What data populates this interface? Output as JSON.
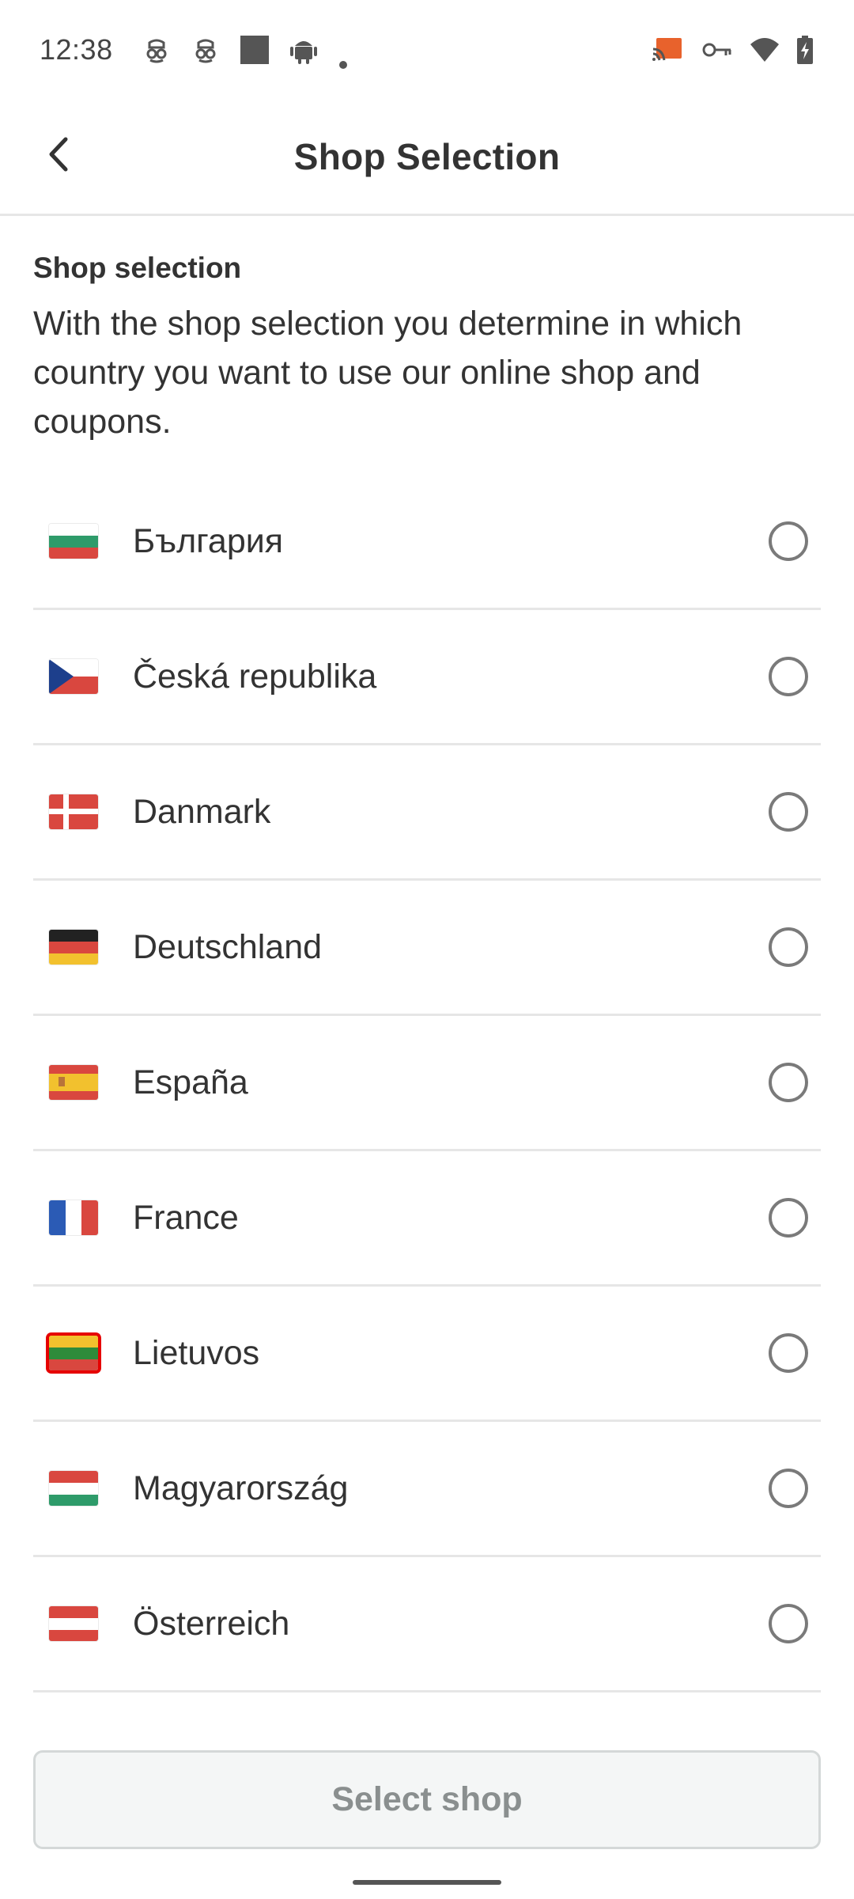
{
  "status_bar": {
    "time": "12:38",
    "left_icons": [
      "incognito-icon",
      "incognito-icon",
      "square-icon",
      "android-icon",
      "dot-icon"
    ],
    "right_icons": [
      "cast-icon",
      "vpn-key-icon",
      "wifi-icon",
      "battery-charging-icon"
    ]
  },
  "app_bar": {
    "title": "Shop Selection",
    "back_icon": "chevron-left-icon"
  },
  "intro": {
    "heading": "Shop selection",
    "text": "With the shop selection you determine in which country you want to use our online shop and coupons."
  },
  "shops": [
    {
      "label": "България",
      "flag": "bulgaria",
      "selected": false
    },
    {
      "label": "Česká republika",
      "flag": "czech",
      "selected": false
    },
    {
      "label": "Danmark",
      "flag": "denmark",
      "selected": false
    },
    {
      "label": "Deutschland",
      "flag": "germany",
      "selected": false
    },
    {
      "label": "España",
      "flag": "spain",
      "selected": false
    },
    {
      "label": "France",
      "flag": "france",
      "selected": false
    },
    {
      "label": "Lietuvos",
      "flag": "lithuania",
      "selected": false
    },
    {
      "label": "Magyarország",
      "flag": "hungary",
      "selected": false
    },
    {
      "label": "Österreich",
      "flag": "austria",
      "selected": false
    }
  ],
  "footer": {
    "select_button_label": "Select shop"
  },
  "colors": {
    "text": "#333333",
    "divider": "#e6e6e6",
    "radio_border": "#7a7a7a",
    "button_bg": "#f4f6f6",
    "button_text": "#8a8f8f",
    "lithuania_highlight": "#e60000"
  }
}
